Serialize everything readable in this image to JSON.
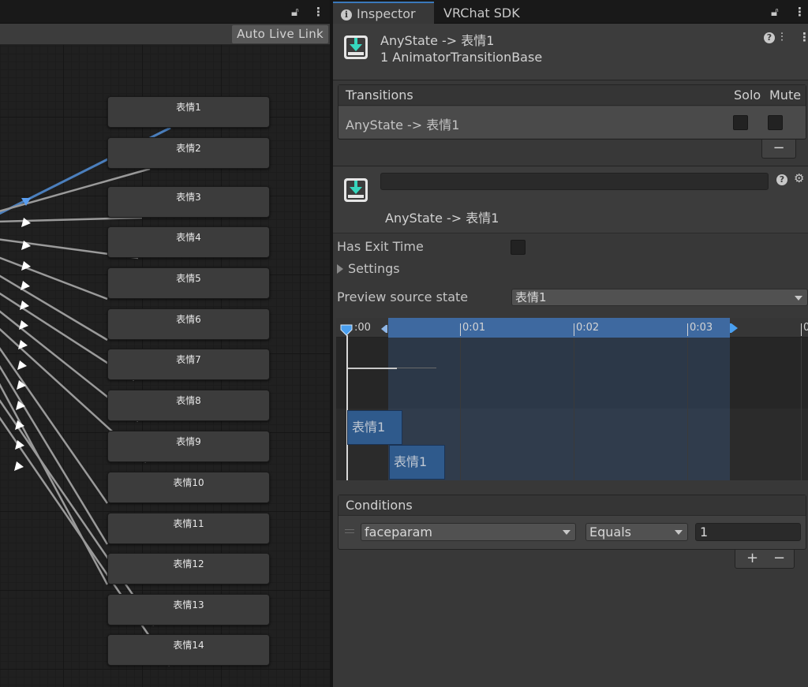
{
  "graph": {
    "live_link_label": "Auto Live Link",
    "states": [
      "表情1",
      "表情2",
      "表情3",
      "表情4",
      "表情5",
      "表情6",
      "表情7",
      "表情8",
      "表情9",
      "表情10",
      "表情11",
      "表情12",
      "表情13",
      "表情14"
    ]
  },
  "inspector": {
    "tabs": {
      "inspector": "Inspector",
      "vrchat_sdk": "VRChat SDK"
    },
    "header": {
      "title": "AnyState -> 表情1",
      "subtitle": "1 AnimatorTransitionBase"
    },
    "transitions": {
      "title": "Transitions",
      "solo_label": "Solo",
      "mute_label": "Mute",
      "rows": [
        {
          "label": "AnyState -> 表情1",
          "solo": false,
          "mute": false
        }
      ],
      "remove_label": "−"
    },
    "detail": {
      "name_value": "",
      "label": "AnyState -> 表情1",
      "has_exit_time_label": "Has Exit Time",
      "has_exit_time": false,
      "settings_label": "Settings",
      "preview_source_label": "Preview source state",
      "preview_source_value": "表情1"
    },
    "timeline": {
      "ticks": [
        ":00",
        "0:01",
        "0:02",
        "0:03",
        "0"
      ],
      "source_clip": "表情1",
      "dest_clip": "表情1"
    },
    "conditions": {
      "title": "Conditions",
      "parameter": "faceparam",
      "mode": "Equals",
      "value": "1",
      "add_label": "+",
      "remove_label": "−"
    }
  },
  "colors": {
    "accent": "#3a79bb",
    "transition_blue": "#3e69a0",
    "icon_teal": "#36d6bd"
  }
}
